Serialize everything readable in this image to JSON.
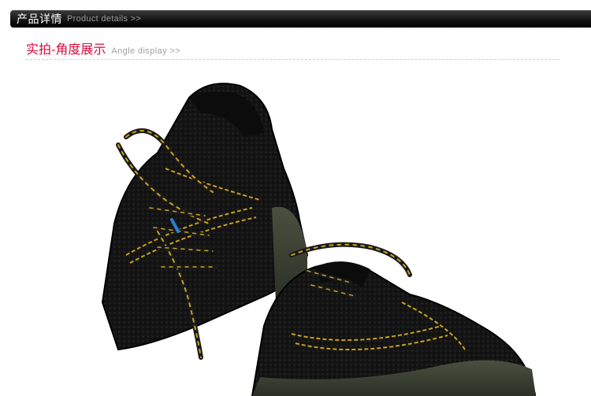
{
  "header": {
    "title": "产品详情",
    "subtitle": "Product details >>"
  },
  "section": {
    "title": "实拍-角度展示",
    "subtitle": "Angle display >>"
  },
  "photo": {
    "subject": "black safety shoes pair",
    "colors": {
      "leather": "#121212",
      "stitch": "#c9a21a",
      "sole": "#3c4134",
      "background": "#ffffff"
    }
  }
}
